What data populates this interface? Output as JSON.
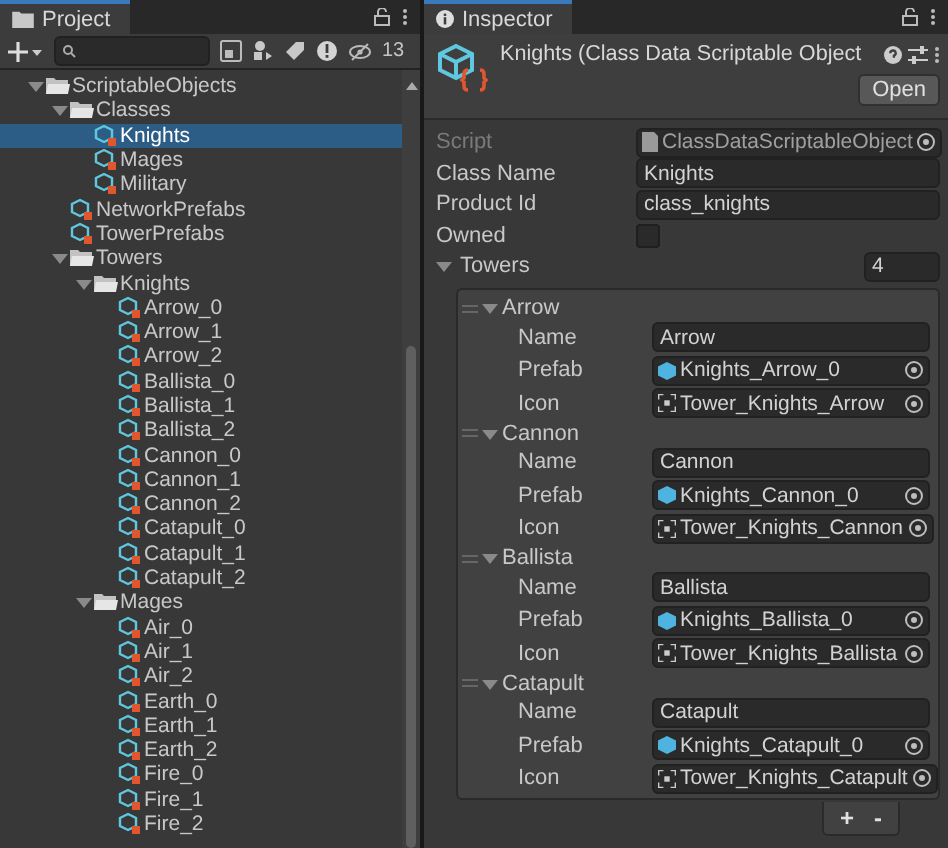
{
  "project": {
    "tab": "Project",
    "hidden_count": "13",
    "tree": [
      {
        "label": "ScriptableObjects",
        "kind": "folder",
        "expanded": true,
        "selected": false,
        "children": [
          {
            "label": "Classes",
            "kind": "folder",
            "expanded": true,
            "selected": false,
            "children": [
              {
                "label": "Knights",
                "kind": "asset",
                "selected": true
              },
              {
                "label": "Mages",
                "kind": "asset",
                "selected": false
              },
              {
                "label": "Military",
                "kind": "asset",
                "selected": false
              }
            ]
          },
          {
            "label": "NetworkPrefabs",
            "kind": "asset",
            "selected": false
          },
          {
            "label": "TowerPrefabs",
            "kind": "asset",
            "selected": false
          },
          {
            "label": "Towers",
            "kind": "folder",
            "expanded": true,
            "selected": false,
            "children": [
              {
                "label": "Knights",
                "kind": "folder",
                "expanded": true,
                "selected": false,
                "children": [
                  {
                    "label": "Arrow_0",
                    "kind": "asset",
                    "selected": false
                  },
                  {
                    "label": "Arrow_1",
                    "kind": "asset",
                    "selected": false
                  },
                  {
                    "label": "Arrow_2",
                    "kind": "asset",
                    "selected": false
                  },
                  {
                    "label": "Ballista_0",
                    "kind": "asset",
                    "selected": false
                  },
                  {
                    "label": "Ballista_1",
                    "kind": "asset",
                    "selected": false
                  },
                  {
                    "label": "Ballista_2",
                    "kind": "asset",
                    "selected": false
                  },
                  {
                    "label": "Cannon_0",
                    "kind": "asset",
                    "selected": false
                  },
                  {
                    "label": "Cannon_1",
                    "kind": "asset",
                    "selected": false
                  },
                  {
                    "label": "Cannon_2",
                    "kind": "asset",
                    "selected": false
                  },
                  {
                    "label": "Catapult_0",
                    "kind": "asset",
                    "selected": false
                  },
                  {
                    "label": "Catapult_1",
                    "kind": "asset",
                    "selected": false
                  },
                  {
                    "label": "Catapult_2",
                    "kind": "asset",
                    "selected": false
                  }
                ]
              },
              {
                "label": "Mages",
                "kind": "folder",
                "expanded": true,
                "selected": false,
                "children": [
                  {
                    "label": "Air_0",
                    "kind": "asset",
                    "selected": false
                  },
                  {
                    "label": "Air_1",
                    "kind": "asset",
                    "selected": false
                  },
                  {
                    "label": "Air_2",
                    "kind": "asset",
                    "selected": false
                  },
                  {
                    "label": "Earth_0",
                    "kind": "asset",
                    "selected": false
                  },
                  {
                    "label": "Earth_1",
                    "kind": "asset",
                    "selected": false
                  },
                  {
                    "label": "Earth_2",
                    "kind": "asset",
                    "selected": false
                  },
                  {
                    "label": "Fire_0",
                    "kind": "asset",
                    "selected": false
                  },
                  {
                    "label": "Fire_1",
                    "kind": "asset",
                    "selected": false
                  },
                  {
                    "label": "Fire_2",
                    "kind": "asset",
                    "selected": false
                  }
                ]
              }
            ]
          }
        ]
      }
    ]
  },
  "inspector": {
    "tab": "Inspector",
    "title": "Knights (Class Data Scriptable Object",
    "open_button": "Open",
    "fields": [
      {
        "label": "Script",
        "kind": "script",
        "value": "ClassDataScriptableObject",
        "disabled": true
      },
      {
        "label": "Class Name",
        "kind": "text",
        "value": "Knights"
      },
      {
        "label": "Product Id",
        "kind": "text",
        "value": "class_knights"
      },
      {
        "label": "Owned",
        "kind": "checkbox",
        "checked": false
      }
    ],
    "towers": {
      "label": "Towers",
      "expanded": true,
      "size": "4",
      "elements": [
        {
          "title": "Arrow",
          "expanded": true,
          "fields": [
            {
              "label": "Name",
              "kind": "text",
              "value": "Arrow"
            },
            {
              "label": "Prefab",
              "kind": "prefab",
              "value": "Knights_Arrow_0"
            },
            {
              "label": "Icon",
              "kind": "sprite",
              "value": "Tower_Knights_Arrow"
            }
          ]
        },
        {
          "title": "Cannon",
          "expanded": true,
          "fields": [
            {
              "label": "Name",
              "kind": "text",
              "value": "Cannon"
            },
            {
              "label": "Prefab",
              "kind": "prefab",
              "value": "Knights_Cannon_0"
            },
            {
              "label": "Icon",
              "kind": "sprite",
              "value": "Tower_Knights_Cannon"
            }
          ]
        },
        {
          "title": "Ballista",
          "expanded": true,
          "fields": [
            {
              "label": "Name",
              "kind": "text",
              "value": "Ballista"
            },
            {
              "label": "Prefab",
              "kind": "prefab",
              "value": "Knights_Ballista_0"
            },
            {
              "label": "Icon",
              "kind": "sprite",
              "value": "Tower_Knights_Ballista"
            }
          ]
        },
        {
          "title": "Catapult",
          "expanded": true,
          "fields": [
            {
              "label": "Name",
              "kind": "text",
              "value": "Catapult"
            },
            {
              "label": "Prefab",
              "kind": "prefab",
              "value": "Knights_Catapult_0"
            },
            {
              "label": "Icon",
              "kind": "sprite",
              "value": "Tower_Knights_Catapult"
            }
          ]
        }
      ],
      "add_button": "+",
      "remove_button": "-"
    }
  }
}
